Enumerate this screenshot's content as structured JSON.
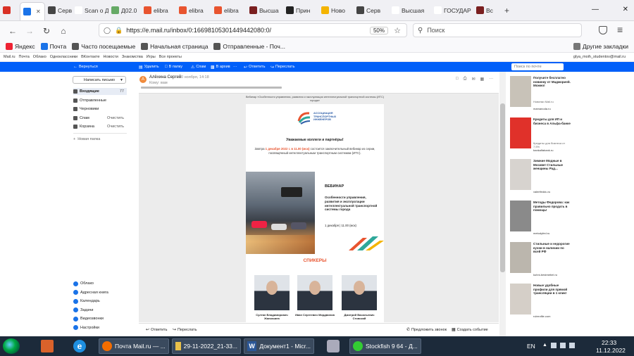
{
  "browser": {
    "tabs": [
      {
        "label": "",
        "icon": "red-circle",
        "color": "#d93025"
      },
      {
        "label": "",
        "icon": "mail-icon",
        "color": "#1a73e8",
        "active": true
      },
      {
        "label": "Серв",
        "icon": "globe-icon",
        "color": "#444"
      },
      {
        "label": "Scan o ДГ",
        "icon": "",
        "color": "#fff"
      },
      {
        "label": "Д02.0",
        "icon": "doc-icon",
        "color": "#6a6"
      },
      {
        "label": "elibra",
        "icon": "e-icon",
        "color": "#e8542f"
      },
      {
        "label": "elibra",
        "icon": "e-icon",
        "color": "#e8542f"
      },
      {
        "label": "elibra",
        "icon": "e-icon",
        "color": "#e8542f"
      },
      {
        "label": "Высша",
        "icon": "vak-icon",
        "color": "#7a1f1f"
      },
      {
        "label": "Прин",
        "icon": "w-icon",
        "color": "#222"
      },
      {
        "label": "Ново",
        "icon": "drive-icon",
        "color": "#f4b400"
      },
      {
        "label": "Серв",
        "icon": "globe-icon",
        "color": "#444"
      },
      {
        "label": "Высшая",
        "icon": "",
        "color": "#fff"
      },
      {
        "label": "ГОСУДАР",
        "icon": "",
        "color": "#fff"
      },
      {
        "label": "Вс",
        "icon": "vak-icon",
        "color": "#7a1f1f"
      }
    ],
    "url": "https://e.mail.ru/inbox/0:16698105301449442080:0/",
    "zoom": "50%",
    "search_placeholder": "Поиск",
    "bookmarks": [
      "Яндекс",
      "Почта",
      "Часто посещаемые",
      "Начальная страница",
      "Отправленные - Поч..."
    ],
    "other_bookmarks": "Другие закладки"
  },
  "portal": {
    "links": [
      "Mail.ru",
      "Почта",
      "Облако",
      "Одноклассники",
      "ВКонтакте",
      "Новости",
      "Знакомства",
      "Игры",
      "Все проекты"
    ],
    "user": "glya_moih_studentov@mail.ru"
  },
  "toolbar": {
    "back": "Вернуться",
    "delete": "Удалить",
    "to_folder": "В папку",
    "spam": "Спам",
    "more": "В архив",
    "reply": "Ответить",
    "forward": "Переслать",
    "search_placeholder": "Поиск по почте"
  },
  "sidebar": {
    "write": "Написать письмо",
    "folders": [
      {
        "label": "Входящие",
        "count": "77"
      },
      {
        "label": "Отправленные",
        "count": ""
      },
      {
        "label": "Черновики",
        "count": ""
      },
      {
        "label": "Спам",
        "count": "Очистить"
      },
      {
        "label": "Корзина",
        "count": "Очистить"
      }
    ],
    "new_folder": "Новая папка",
    "apps": [
      {
        "label": "Облако",
        "color": "#1a73e8"
      },
      {
        "label": "Адресная книга",
        "color": "#1a73e8"
      },
      {
        "label": "Календарь",
        "color": "#1a73e8"
      },
      {
        "label": "Задачи",
        "color": "#1a73e8"
      },
      {
        "label": "Видеозвонки",
        "color": "#1a73e8"
      },
      {
        "label": "Настройки",
        "color": "#1a73e8"
      }
    ]
  },
  "message": {
    "sender": "Алёхина Сергей",
    "date": "30 ноября, 14:18",
    "to": "Кому: вам",
    "preheader": "Вебинар «Особенности управления, развития и эксплуатации интеллектуальной транспортной системы (ИТС) города»",
    "org_name": "АССОЦИАЦИЯ ТРАНСПОРТНЫХ ИНЖЕНЕРОВ",
    "greeting": "Уважаемые коллеги и партнёры!",
    "intro_prefix": "Завтра ",
    "intro_date": "1 декабря 2022 г. в 11.00 (мск)",
    "intro_suffix": " состоится заключительный вебинар из серии, посвящённый интеллектуальным транспортным системам (ИТС).",
    "webinar_label": "ВЕБИНАР",
    "webinar_title": "Особенности управления, развития и эксплуатации интеллектуальной транспортной системы города",
    "webinar_time": "1 декабря | 11.00 (мск)",
    "speakers_title": "СПИКЕРЫ",
    "speakers": [
      {
        "name": "Султан Владимирович Жанказиев",
        "position": "Президент Ассоциации транспортных инженеров"
      },
      {
        "name": "Иван Сергеевич Мордвинов",
        "position": "Зам. генерального директора ООО «ЦОДД Москва»"
      },
      {
        "name": "Дмитрий Васильевич Стовский",
        "position": "Зам. генерального директора SIMETRA"
      }
    ]
  },
  "footer": {
    "reply": "Ответить",
    "forward": "Переслать",
    "offer_call": "Предложить звонок",
    "create_event": "Создать событие"
  },
  "ads": [
    {
      "title": "Получите бесплатно новинку от Маджорией. Можно!",
      "sub": "Новинки Mail.ru",
      "domain": "mamanoda.ru",
      "color": "#c8c2b8"
    },
    {
      "title": "Кредиты для ИП и бизнеса в Альфа-банке",
      "sub": "Кредиты для бизнеса от 7,5%",
      "domain": "bankalfabank.ru",
      "color": "#e0312a"
    },
    {
      "title": "Зимние Модные в Москве! Стильные женщины Рад...",
      "sub": "",
      "domain": "valerifeddu.ru",
      "color": "#d7d3cf"
    },
    {
      "title": "Методы Федорова: как правильно продать в помощь!",
      "sub": "",
      "domain": "metodyfed.ru",
      "color": "#8a8a8a"
    },
    {
      "title": "Стильные и недорогие кухни в наличии по всей РФ",
      "sub": "",
      "domain": "kuhni-bestmebel.ru",
      "color": "#bbb6ad"
    },
    {
      "title": "Новые удобные профили для прямой трансляции в 1 клик!",
      "sub": "",
      "domain": "rubrrofile.com",
      "color": "#d5cfc8"
    }
  ],
  "taskbar": {
    "items": [
      "Почта Mail.ru — ...",
      "29-11-2022_21-33...",
      "Документ1 - Micr...",
      "Stockfish 9 64 - Д..."
    ],
    "lang": "EN",
    "time": "22:33",
    "date": "11.12.2022"
  }
}
